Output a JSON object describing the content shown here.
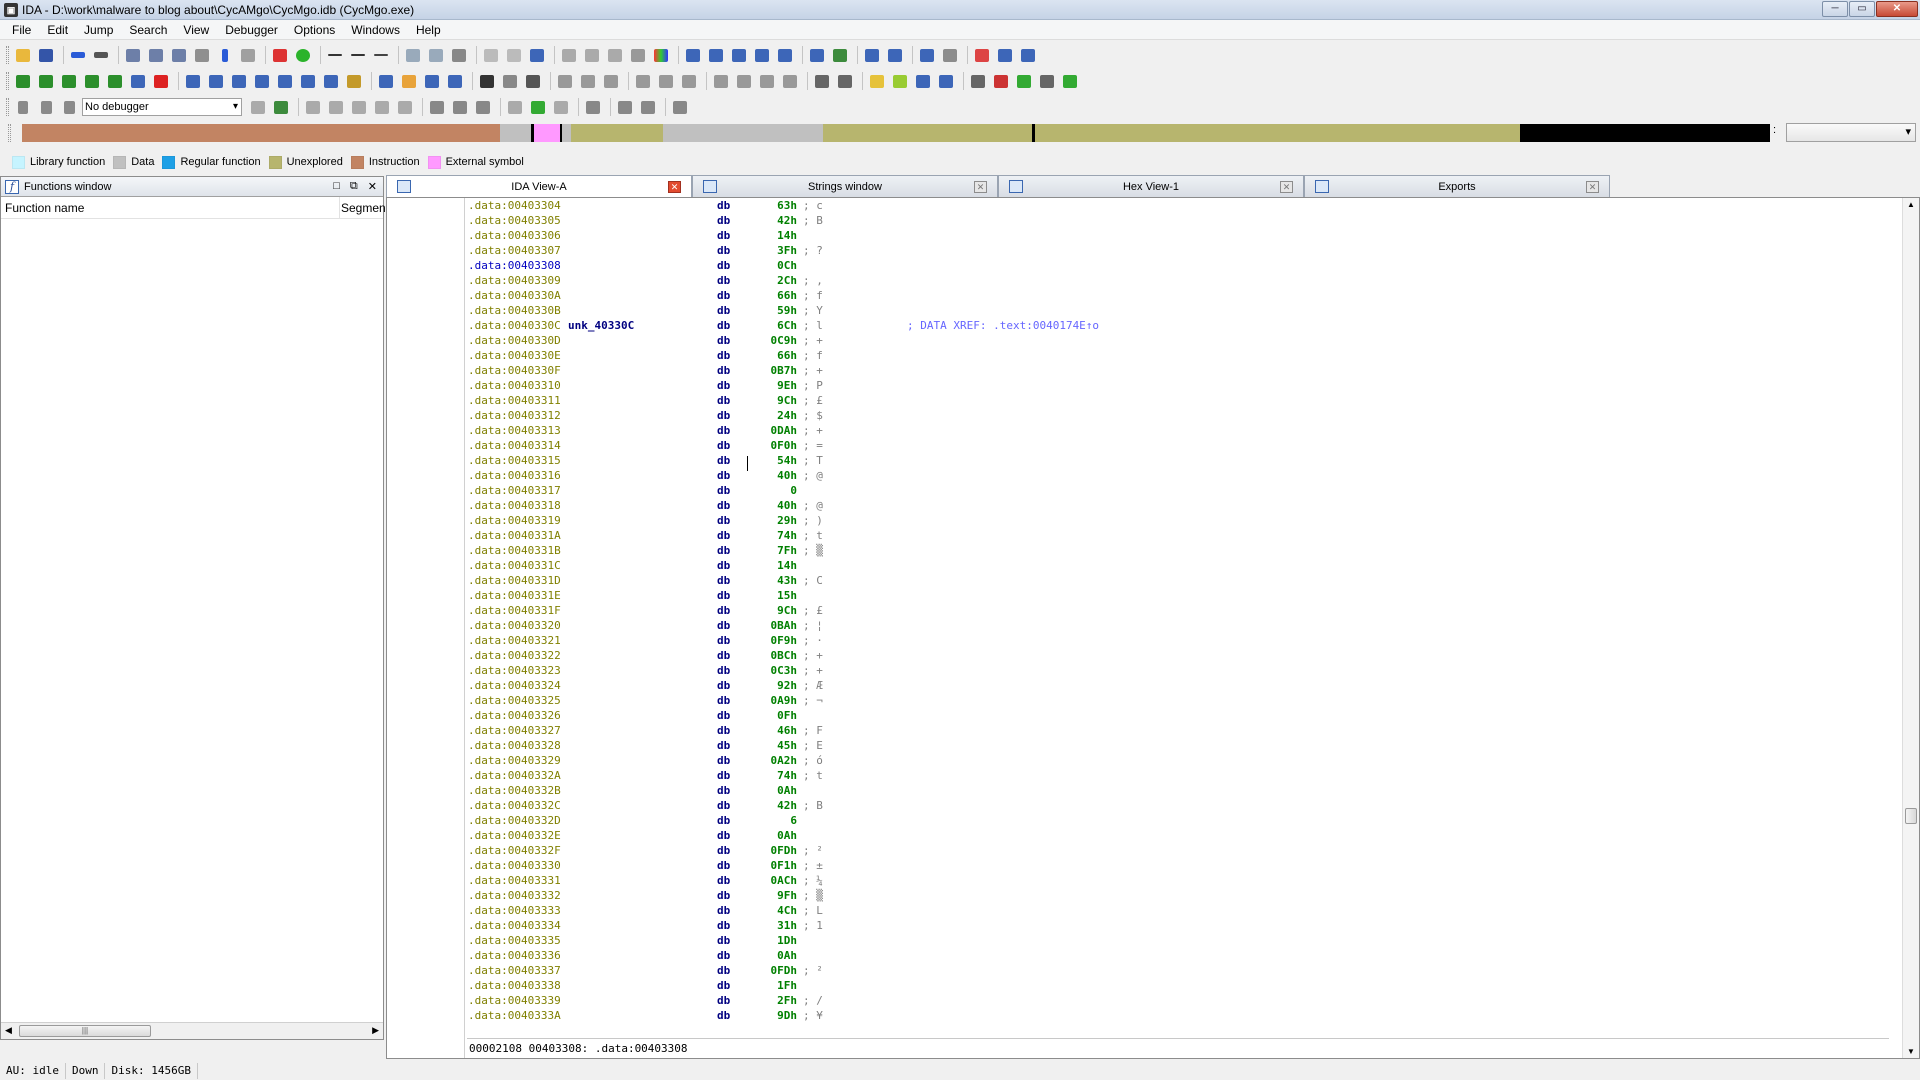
{
  "window": {
    "title": "IDA - D:\\work\\malware to blog about\\CycAMgo\\CycMgo.idb (CycMgo.exe)",
    "buttons": [
      "─",
      "▭",
      "✕"
    ]
  },
  "menu": [
    "File",
    "Edit",
    "Jump",
    "Search",
    "View",
    "Debugger",
    "Options",
    "Windows",
    "Help"
  ],
  "toolbar": {
    "debugger_select": "No debugger"
  },
  "legend": [
    {
      "label": "Library function",
      "color": "#c6f4ff"
    },
    {
      "label": "Data",
      "color": "#c0c0c0"
    },
    {
      "label": "Regular function",
      "color": "#1ea0e6"
    },
    {
      "label": "Unexplored",
      "color": "#b7b56e"
    },
    {
      "label": "Instruction",
      "color": "#c28463"
    },
    {
      "label": "External symbol",
      "color": "#ff99ff"
    }
  ],
  "functions_window": {
    "title": "Functions window",
    "col_name": "Function name",
    "col_segment": "Segmen"
  },
  "tabs": [
    {
      "label": "IDA View-A",
      "active": true
    },
    {
      "label": "Strings window",
      "active": false
    },
    {
      "label": "Hex View-1",
      "active": false
    },
    {
      "label": "Exports",
      "active": false
    }
  ],
  "listing": [
    {
      "addr": ".data:00403304",
      "mnem": "db",
      "val": "63h",
      "cmt": "; c"
    },
    {
      "addr": ".data:00403305",
      "mnem": "db",
      "val": "42h",
      "cmt": "; B"
    },
    {
      "addr": ".data:00403306",
      "mnem": "db",
      "val": "14h",
      "cmt": ""
    },
    {
      "addr": ".data:00403307",
      "mnem": "db",
      "val": "3Fh",
      "cmt": "; ?"
    },
    {
      "addr": ".data:00403308",
      "mnem": "db",
      "val": "0Ch",
      "cmt": "",
      "selected": true
    },
    {
      "addr": ".data:00403309",
      "mnem": "db",
      "val": "2Ch",
      "cmt": "; ,"
    },
    {
      "addr": ".data:0040330A",
      "mnem": "db",
      "val": "66h",
      "cmt": "; f"
    },
    {
      "addr": ".data:0040330B",
      "mnem": "db",
      "val": "59h",
      "cmt": "; Y"
    },
    {
      "addr": ".data:0040330C",
      "label": "unk_40330C",
      "mnem": "db",
      "val": "6Ch",
      "cmt": "; l",
      "xref": "; DATA XREF: .text:0040174E↑o"
    },
    {
      "addr": ".data:0040330D",
      "mnem": "db",
      "val": "0C9h",
      "cmt": "; +"
    },
    {
      "addr": ".data:0040330E",
      "mnem": "db",
      "val": "66h",
      "cmt": "; f"
    },
    {
      "addr": ".data:0040330F",
      "mnem": "db",
      "val": "0B7h",
      "cmt": "; +"
    },
    {
      "addr": ".data:00403310",
      "mnem": "db",
      "val": "9Eh",
      "cmt": "; P"
    },
    {
      "addr": ".data:00403311",
      "mnem": "db",
      "val": "9Ch",
      "cmt": "; £"
    },
    {
      "addr": ".data:00403312",
      "mnem": "db",
      "val": "24h",
      "cmt": "; $"
    },
    {
      "addr": ".data:00403313",
      "mnem": "db",
      "val": "0DAh",
      "cmt": "; +"
    },
    {
      "addr": ".data:00403314",
      "mnem": "db",
      "val": "0F0h",
      "cmt": "; ="
    },
    {
      "addr": ".data:00403315",
      "mnem": "db",
      "val": "54h",
      "cmt": "; T"
    },
    {
      "addr": ".data:00403316",
      "mnem": "db",
      "val": "40h",
      "cmt": "; @"
    },
    {
      "addr": ".data:00403317",
      "mnem": "db",
      "val": "0",
      "cmt": ""
    },
    {
      "addr": ".data:00403318",
      "mnem": "db",
      "val": "40h",
      "cmt": "; @"
    },
    {
      "addr": ".data:00403319",
      "mnem": "db",
      "val": "29h",
      "cmt": "; )"
    },
    {
      "addr": ".data:0040331A",
      "mnem": "db",
      "val": "74h",
      "cmt": "; t"
    },
    {
      "addr": ".data:0040331B",
      "mnem": "db",
      "val": "7Fh",
      "cmt": "; ▒"
    },
    {
      "addr": ".data:0040331C",
      "mnem": "db",
      "val": "14h",
      "cmt": ""
    },
    {
      "addr": ".data:0040331D",
      "mnem": "db",
      "val": "43h",
      "cmt": "; C"
    },
    {
      "addr": ".data:0040331E",
      "mnem": "db",
      "val": "15h",
      "cmt": ""
    },
    {
      "addr": ".data:0040331F",
      "mnem": "db",
      "val": "9Ch",
      "cmt": "; £"
    },
    {
      "addr": ".data:00403320",
      "mnem": "db",
      "val": "0BAh",
      "cmt": "; ¦"
    },
    {
      "addr": ".data:00403321",
      "mnem": "db",
      "val": "0F9h",
      "cmt": "; ·"
    },
    {
      "addr": ".data:00403322",
      "mnem": "db",
      "val": "0BCh",
      "cmt": "; +"
    },
    {
      "addr": ".data:00403323",
      "mnem": "db",
      "val": "0C3h",
      "cmt": "; +"
    },
    {
      "addr": ".data:00403324",
      "mnem": "db",
      "val": "92h",
      "cmt": "; Æ"
    },
    {
      "addr": ".data:00403325",
      "mnem": "db",
      "val": "0A9h",
      "cmt": "; ¬"
    },
    {
      "addr": ".data:00403326",
      "mnem": "db",
      "val": "0Fh",
      "cmt": ""
    },
    {
      "addr": ".data:00403327",
      "mnem": "db",
      "val": "46h",
      "cmt": "; F"
    },
    {
      "addr": ".data:00403328",
      "mnem": "db",
      "val": "45h",
      "cmt": "; E"
    },
    {
      "addr": ".data:00403329",
      "mnem": "db",
      "val": "0A2h",
      "cmt": "; ó"
    },
    {
      "addr": ".data:0040332A",
      "mnem": "db",
      "val": "74h",
      "cmt": "; t"
    },
    {
      "addr": ".data:0040332B",
      "mnem": "db",
      "val": "0Ah",
      "cmt": ""
    },
    {
      "addr": ".data:0040332C",
      "mnem": "db",
      "val": "42h",
      "cmt": "; B"
    },
    {
      "addr": ".data:0040332D",
      "mnem": "db",
      "val": "6",
      "cmt": ""
    },
    {
      "addr": ".data:0040332E",
      "mnem": "db",
      "val": "0Ah",
      "cmt": ""
    },
    {
      "addr": ".data:0040332F",
      "mnem": "db",
      "val": "0FDh",
      "cmt": "; ²"
    },
    {
      "addr": ".data:00403330",
      "mnem": "db",
      "val": "0F1h",
      "cmt": "; ±"
    },
    {
      "addr": ".data:00403331",
      "mnem": "db",
      "val": "0ACh",
      "cmt": "; ¼"
    },
    {
      "addr": ".data:00403332",
      "mnem": "db",
      "val": "9Fh",
      "cmt": "; ▒"
    },
    {
      "addr": ".data:00403333",
      "mnem": "db",
      "val": "4Ch",
      "cmt": "; L"
    },
    {
      "addr": ".data:00403334",
      "mnem": "db",
      "val": "31h",
      "cmt": "; 1"
    },
    {
      "addr": ".data:00403335",
      "mnem": "db",
      "val": "1Dh",
      "cmt": ""
    },
    {
      "addr": ".data:00403336",
      "mnem": "db",
      "val": "0Ah",
      "cmt": ""
    },
    {
      "addr": ".data:00403337",
      "mnem": "db",
      "val": "0FDh",
      "cmt": "; ²"
    },
    {
      "addr": ".data:00403338",
      "mnem": "db",
      "val": "1Fh",
      "cmt": ""
    },
    {
      "addr": ".data:00403339",
      "mnem": "db",
      "val": "2Fh",
      "cmt": "; /"
    },
    {
      "addr": ".data:0040333A",
      "mnem": "db",
      "val": "9Dh",
      "cmt": "; ¥"
    }
  ],
  "view_status": "00002108 00403308: .data:00403308",
  "statusbar": {
    "au": "AU:  idle",
    "dir": "Down",
    "disk": "Disk: 1456GB"
  },
  "colors": {
    "address": "#808000",
    "mnemonic": "#000080",
    "value": "#008000",
    "xref": "#6666ff",
    "dot": "#3fb8ef"
  }
}
